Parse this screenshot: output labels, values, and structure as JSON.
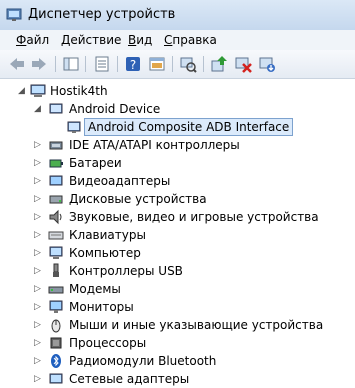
{
  "window": {
    "title": "Диспетчер устройств"
  },
  "menu": {
    "file": {
      "ul": "Ф",
      "rest": "айл"
    },
    "action": {
      "ul": "Д",
      "rest": "ействие"
    },
    "view": {
      "ul": "В",
      "rest": "ид"
    },
    "help": {
      "ul": "С",
      "rest": "правка"
    }
  },
  "toolbar": {
    "icons": [
      "back-icon",
      "forward-icon",
      "show-hide-tree-icon",
      "properties-icon",
      "help-icon",
      "view-console-icon",
      "scan-hardware-icon",
      "update-driver-icon",
      "disable-device-icon",
      "uninstall-device-icon"
    ]
  },
  "tree": {
    "root": "Hostik4th",
    "items": [
      {
        "label": "Android Device",
        "expanded": true
      },
      {
        "label": "Android Composite ADB Interface",
        "child": true,
        "selected": true
      },
      {
        "label": "IDE ATA/ATAPI контроллеры"
      },
      {
        "label": "Батареи"
      },
      {
        "label": "Видеоадаптеры"
      },
      {
        "label": "Дисковые устройства"
      },
      {
        "label": "Звуковые, видео и игровые устройства"
      },
      {
        "label": "Клавиатуры"
      },
      {
        "label": "Компьютер"
      },
      {
        "label": "Контроллеры USB"
      },
      {
        "label": "Модемы"
      },
      {
        "label": "Мониторы"
      },
      {
        "label": "Мыши и иные указывающие устройства"
      },
      {
        "label": "Процессоры"
      },
      {
        "label": "Радиомодули Bluetooth"
      },
      {
        "label": "Сетевые адаптеры"
      }
    ]
  }
}
